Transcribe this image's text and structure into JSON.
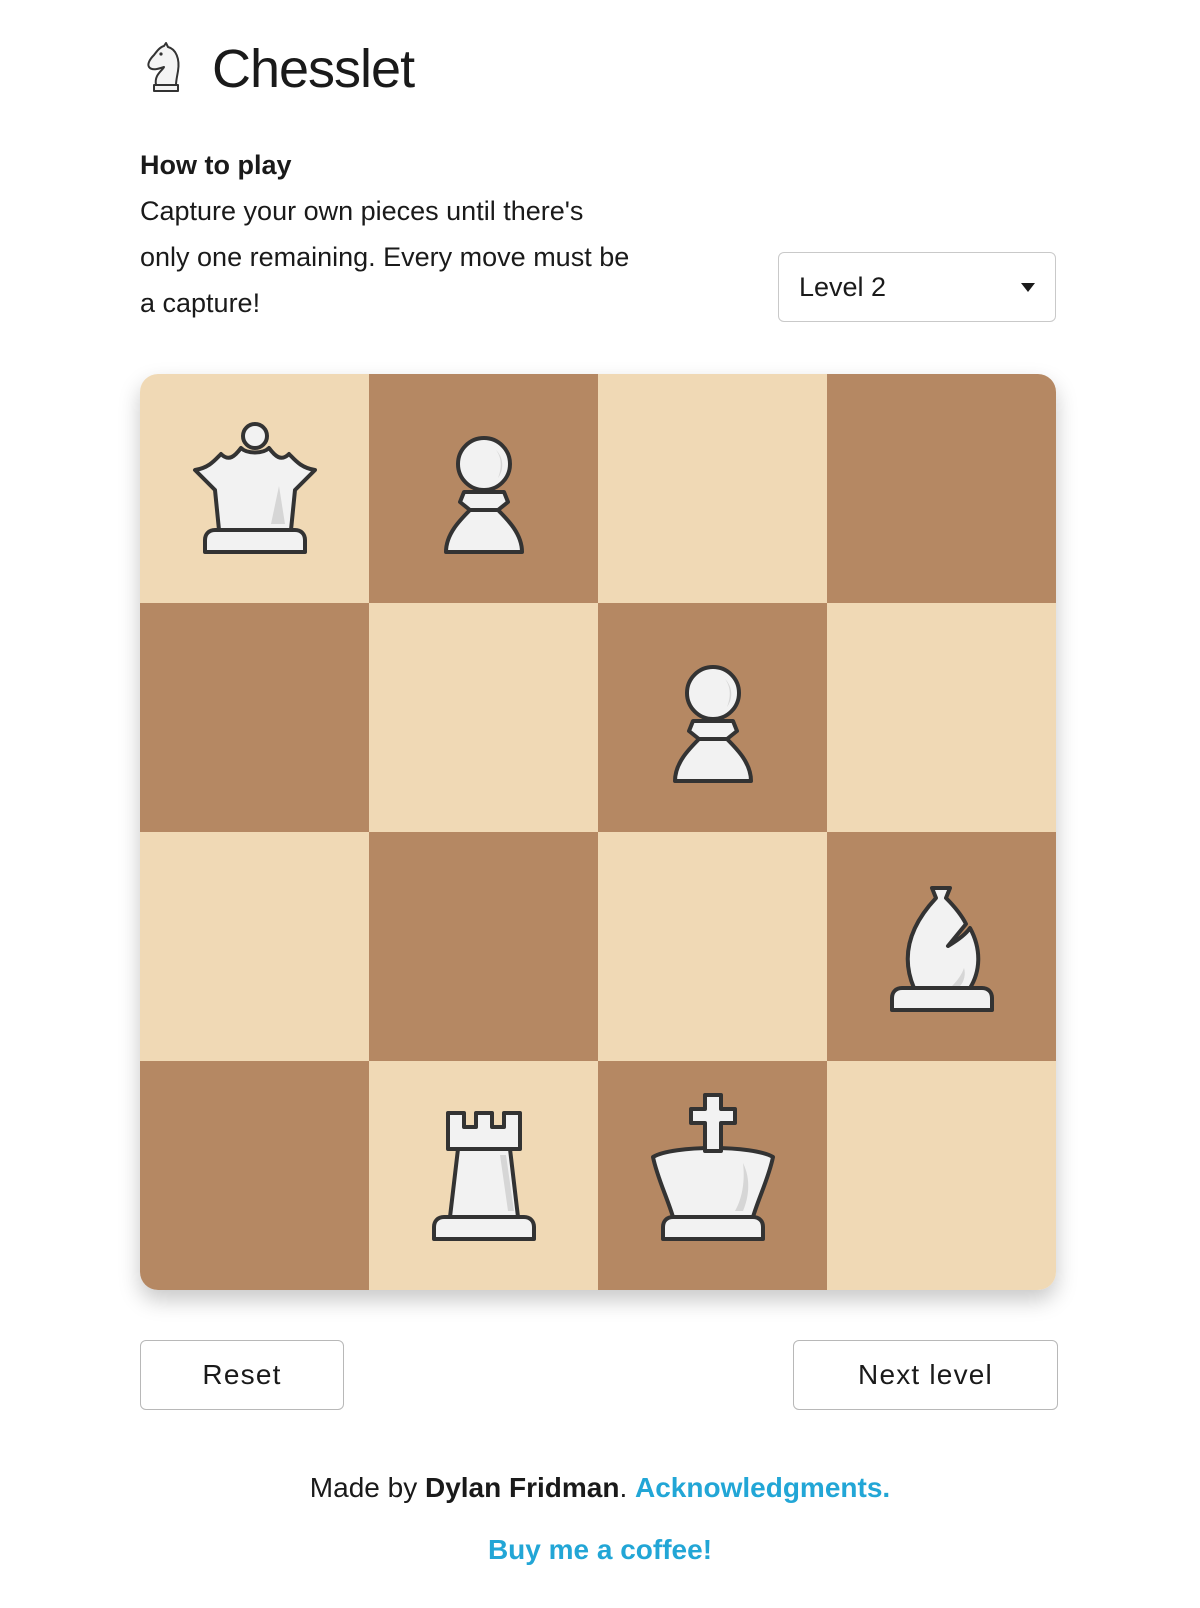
{
  "app": {
    "title": "Chesslet",
    "logo_icon": "knight-icon"
  },
  "howto": {
    "title": "How to play",
    "text": "Capture your own pieces until there's only one remaining. Every move must be a capture!"
  },
  "level_select": {
    "selected": "Level 2"
  },
  "board": {
    "light_color": "#f0d9b5",
    "dark_color": "#b58863",
    "squares": [
      [
        "queen",
        "pawn",
        "",
        ""
      ],
      [
        "",
        "",
        "pawn",
        ""
      ],
      [
        "",
        "",
        "",
        "bishop"
      ],
      [
        "",
        "rook",
        "king",
        ""
      ]
    ]
  },
  "buttons": {
    "reset": "Reset",
    "next": "Next level"
  },
  "footer": {
    "made_by": "Made by ",
    "author": "Dylan Fridman",
    "sep": ". ",
    "ack_link": "Acknowledgments.",
    "coffee_link": "Buy me a coffee!",
    "link_color": "#22a6d6"
  }
}
